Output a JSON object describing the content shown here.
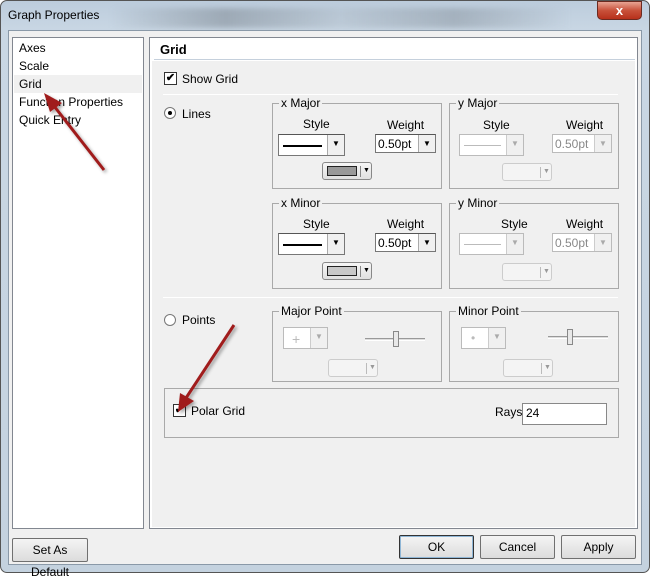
{
  "window": {
    "title": "Graph Properties",
    "close_label": "x"
  },
  "sidebar": {
    "items": [
      {
        "label": "Axes"
      },
      {
        "label": "Scale"
      },
      {
        "label": "Grid",
        "selected": true
      },
      {
        "label": "Function Properties"
      },
      {
        "label": "Quick Entry"
      }
    ]
  },
  "panel": {
    "title": "Grid",
    "show_grid": {
      "label": "Show Grid",
      "checked": true
    },
    "lines": {
      "label": "Lines",
      "selected": true
    },
    "x_major": {
      "title": "x Major",
      "style_label": "Style",
      "weight_label": "Weight",
      "weight": "0.50pt",
      "color": "#999999",
      "enabled": true
    },
    "y_major": {
      "title": "y Major",
      "style_label": "Style",
      "weight_label": "Weight",
      "weight": "0.50pt",
      "enabled": false
    },
    "x_minor": {
      "title": "x Minor",
      "style_label": "Style",
      "weight_label": "Weight",
      "weight": "0.50pt",
      "color": "#c8c8c8",
      "enabled": true
    },
    "y_minor": {
      "title": "y Minor",
      "style_label": "Style",
      "weight_label": "Weight",
      "weight": "0.50pt",
      "enabled": false
    },
    "points": {
      "label": "Points",
      "selected": false
    },
    "major_point": {
      "title": "Major Point",
      "symbol": "+",
      "enabled": false
    },
    "minor_point": {
      "title": "Minor Point",
      "symbol": "•",
      "enabled": false
    },
    "polar_grid": {
      "label": "Polar Grid",
      "checked": true
    },
    "rays": {
      "label": "Rays",
      "value": "24"
    }
  },
  "buttons": {
    "set_default": "Set As Default",
    "ok": "OK",
    "cancel": "Cancel",
    "apply": "Apply"
  },
  "colors": {
    "annotation_arrow": "#a01c1c",
    "close_button": "#c8513a"
  }
}
